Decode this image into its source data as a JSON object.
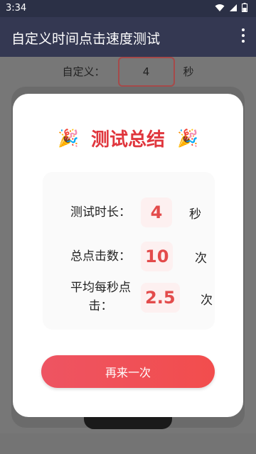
{
  "status_bar": {
    "time": "3:34",
    "icons": [
      "wifi-icon",
      "signal-icon",
      "battery-icon"
    ]
  },
  "app_bar": {
    "title": "自定义时间点击速度测试"
  },
  "background": {
    "custom_label": "自定义：",
    "custom_value": "4",
    "custom_unit": "秒"
  },
  "dialog": {
    "title": "测试总结",
    "title_emoji": "🎉",
    "stats": [
      {
        "label": "测试时长：",
        "value": "4",
        "unit": "秒"
      },
      {
        "label": "总点击数：",
        "value": "10",
        "unit": "次"
      },
      {
        "label_line1": "平均每秒点",
        "label_line2": "击：",
        "value": "2.5",
        "unit": "次"
      }
    ],
    "again_button": "再来一次"
  },
  "colors": {
    "accent": "#e0363d",
    "appbar": "#343852",
    "button": "#ee5462"
  }
}
